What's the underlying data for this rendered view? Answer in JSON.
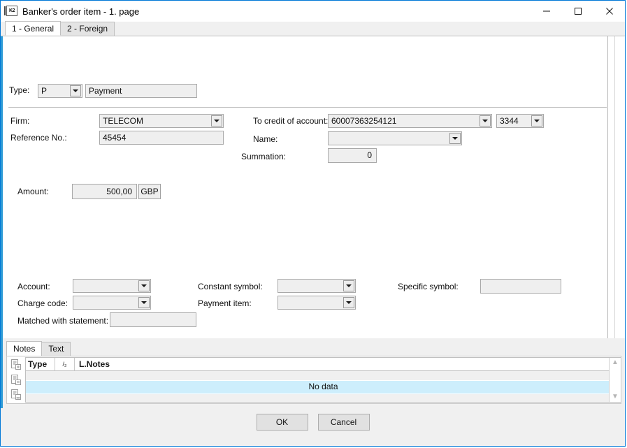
{
  "window": {
    "title": "Banker's order item - 1. page",
    "icon": "app-icon",
    "controls": {
      "minimize": "minimize-icon",
      "maximize": "maximize-icon",
      "close": "close-icon"
    }
  },
  "tabs": [
    {
      "label": "1 - General",
      "active": true
    },
    {
      "label": "2 - Foreign",
      "active": false
    }
  ],
  "form": {
    "type": {
      "label": "Type:",
      "code": "P",
      "description": "Payment"
    },
    "firm": {
      "label": "Firm:",
      "value": "TELECOM"
    },
    "reference_no": {
      "label": "Reference No.:",
      "value": "45454"
    },
    "to_credit_of_account": {
      "label": "To credit of account:",
      "value": "60007363254121",
      "bank_code": "3344"
    },
    "name": {
      "label": "Name:",
      "value": ""
    },
    "summation": {
      "label": "Summation:",
      "value": "0"
    },
    "amount": {
      "label": "Amount:",
      "value": "500,00",
      "currency": "GBP"
    },
    "account": {
      "label": "Account:",
      "value": ""
    },
    "charge_code": {
      "label": "Charge code:",
      "value": ""
    },
    "matched_with_statement": {
      "label": "Matched with statement:",
      "value": ""
    },
    "constant_symbol": {
      "label": "Constant symbol:",
      "value": ""
    },
    "payment_item": {
      "label": "Payment item:",
      "value": ""
    },
    "specific_symbol": {
      "label": "Specific symbol:",
      "value": ""
    }
  },
  "notes": {
    "tabs": [
      {
        "label": "Notes",
        "active": true
      },
      {
        "label": "Text",
        "active": false
      }
    ],
    "side_buttons": [
      "new-note-icon",
      "edit-note-icon",
      "delete-note-icon"
    ],
    "grid": {
      "columns": [
        "Type",
        "/₂",
        "L.Notes"
      ],
      "rows": [],
      "empty_message": "No data"
    }
  },
  "footer": {
    "ok": "OK",
    "cancel": "Cancel"
  },
  "colors": {
    "accent": "#0078d7",
    "panel_edge": "#2e9bd6",
    "row_highlight": "#cdeefc",
    "field_bg": "#efefef"
  }
}
